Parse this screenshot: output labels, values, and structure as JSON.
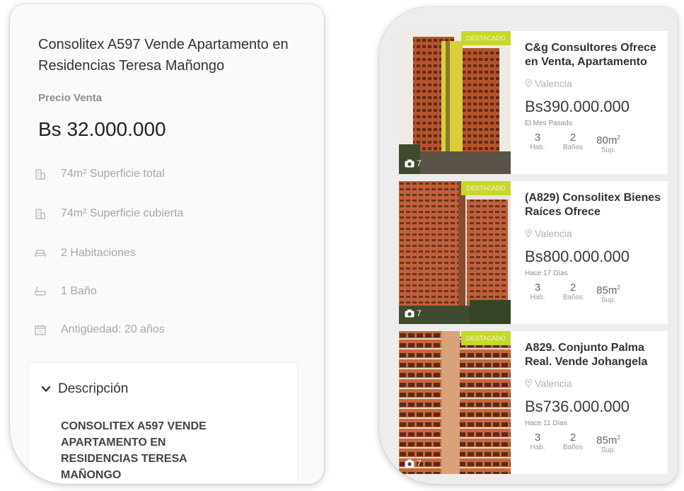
{
  "detail": {
    "title": "Consolitex A597 Vende Apartamento en Residencias Teresa Mañongo",
    "price_label": "Precio Venta",
    "price": "Bs 32.000.000",
    "features": [
      {
        "icon": "building-icon",
        "text": "74m² Superficie total"
      },
      {
        "icon": "building-icon",
        "text": "74m² Superficie cubierta"
      },
      {
        "icon": "bed-icon",
        "text": "2 Habitaciones"
      },
      {
        "icon": "bathtub-icon",
        "text": "1 Baño"
      },
      {
        "icon": "calendar-icon",
        "text": "Antigüedad: 20 años"
      }
    ],
    "description": {
      "title": "Descripción",
      "body": "CONSOLITEX A597 VENDE APARTAMENTO EN RESIDENCIAS TERESA MAÑONGO"
    }
  },
  "listings": [
    {
      "badge": "DESTACADO",
      "photo_count": "7",
      "title": "C&g Consultores Ofrece en Venta, Apartamento",
      "location": "Valencia",
      "price": "Bs390.000.000",
      "date": "El Mes Pasado",
      "hab": "3",
      "hab_label": "Hab.",
      "banos": "2",
      "banos_label": "Baños",
      "sup": "80",
      "sup_label": "Sup."
    },
    {
      "badge": "DESTACADO",
      "photo_count": "7",
      "title": "(A829) Consolitex Bienes Raíces Ofrece",
      "location": "Valencia",
      "price": "Bs800.000.000",
      "date": "Hace 17 Días",
      "hab": "3",
      "hab_label": "Hab.",
      "banos": "2",
      "banos_label": "Baños",
      "sup": "85",
      "sup_label": "Sup."
    },
    {
      "badge": "DESTACADO",
      "photo_count": "7",
      "title": "A829. Conjunto Palma Real. Vende Johangela",
      "location": "Valencia",
      "price": "Bs736.000.000",
      "date": "Hace 11 Días",
      "hab": "3",
      "hab_label": "Hab.",
      "banos": "2",
      "banos_label": "Baños",
      "sup": "85",
      "sup_label": "Sup."
    }
  ],
  "colors": {
    "badge": "#c8d72a",
    "building_facade": "#b5532b",
    "accent_yellow": "#d9cf3b"
  }
}
